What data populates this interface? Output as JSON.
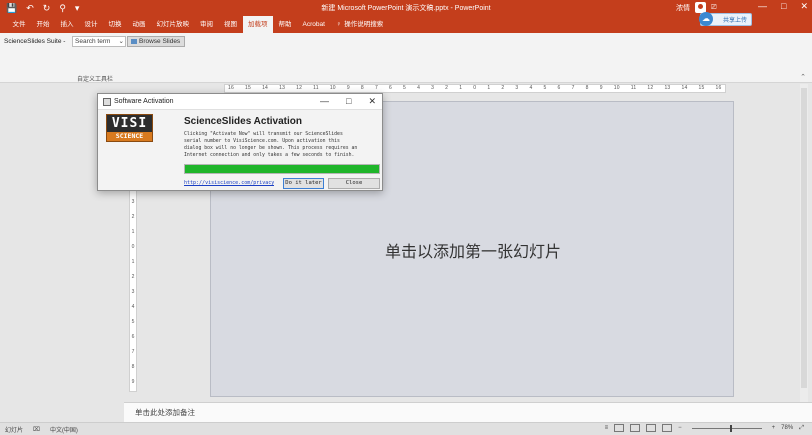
{
  "window": {
    "title": "新建 Microsoft PowerPoint 演示文稿.pptx - PowerPoint",
    "user_name": "浓情",
    "share_label": "共享上传",
    "controls": [
      "—",
      "□",
      "✕"
    ],
    "window_icons": [
      "⎚",
      "◱"
    ]
  },
  "quick_access": [
    "💾",
    "↶",
    "↻",
    "⚲",
    "▾"
  ],
  "ribbon_tabs": [
    {
      "label": "文件",
      "active": false
    },
    {
      "label": "开始",
      "active": false
    },
    {
      "label": "插入",
      "active": false
    },
    {
      "label": "设计",
      "active": false
    },
    {
      "label": "切换",
      "active": false
    },
    {
      "label": "动画",
      "active": false
    },
    {
      "label": "幻灯片放映",
      "active": false
    },
    {
      "label": "审阅",
      "active": false
    },
    {
      "label": "视图",
      "active": false
    },
    {
      "label": "加载项",
      "active": true
    },
    {
      "label": "帮助",
      "active": false
    },
    {
      "label": "Acrobat",
      "active": false
    }
  ],
  "tell_me": "操作说明搜索",
  "ribbon": {
    "scienceslides_label": "ScienceSlides Suite -",
    "search_value": "Search term",
    "browse_label": "Browse Slides",
    "group_label": "自定义工具栏"
  },
  "ruler": {
    "horizontal": [
      "16",
      "15",
      "14",
      "13",
      "12",
      "11",
      "10",
      "9",
      "8",
      "7",
      "6",
      "5",
      "4",
      "3",
      "2",
      "1",
      "0",
      "1",
      "2",
      "3",
      "4",
      "5",
      "6",
      "7",
      "8",
      "9",
      "10",
      "11",
      "12",
      "13",
      "14",
      "15",
      "16"
    ],
    "vertical": [
      "9",
      "8",
      "7",
      "6",
      "5",
      "4",
      "3",
      "2",
      "1",
      "0",
      "1",
      "2",
      "3",
      "4",
      "5",
      "6",
      "7",
      "8",
      "9"
    ]
  },
  "slide": {
    "placeholder": "单击以添加第一张幻灯片"
  },
  "notes": {
    "placeholder": "单击此处添加备注"
  },
  "status": {
    "slide": "幻灯片",
    "language": "中文(中国)",
    "zoom": "78%"
  },
  "dialog": {
    "title": "Software Activation",
    "logo_top": "VISI",
    "logo_bottom": "SCIENCE",
    "heading": "ScienceSlides Activation",
    "body": "Clicking \"Activate Now\" will transmit our ScienceSlides\nserial number to VisiScience.com. Upon activation this\ndialog box will no longer be shown. This process requires an\nInternet connection and only takes a few seconds to finish.",
    "progress": 1.0,
    "progress_color": "#1fb52a",
    "link": "http://visiscience.com/privacy",
    "button_later": "Do it later",
    "button_close": "Close"
  },
  "colors": {
    "accent": "#c43e1c"
  }
}
